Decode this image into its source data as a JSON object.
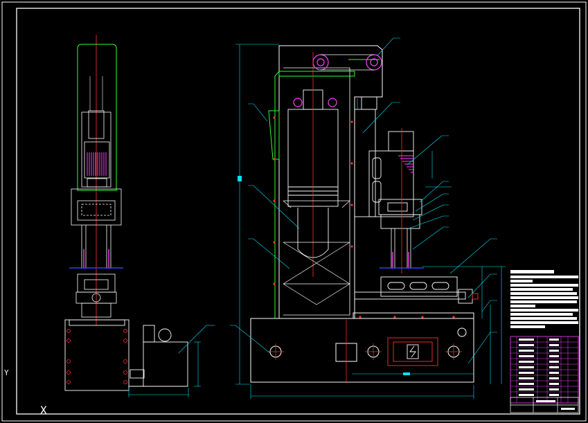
{
  "app": {
    "background": "#000000"
  },
  "drawing": {
    "ucs_y_label": "Y",
    "ucs_x_mark": "X",
    "palette": {
      "frame": "#ffffff",
      "outline": "#ffffff",
      "center_line": "#ff3030",
      "dimension": "#00e5ff",
      "leader": "#00e5ff",
      "guard": "#30ff30",
      "motor_coil": "#ff40ff",
      "bom_grid": "#ff40ff",
      "marker": "#3040ff",
      "bolt": "#ff3030"
    }
  }
}
